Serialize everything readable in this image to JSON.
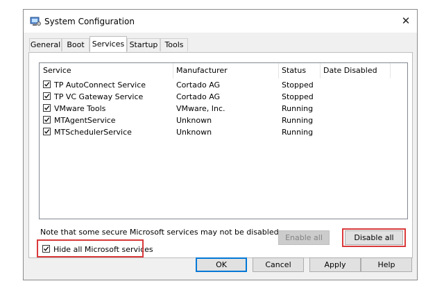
{
  "window": {
    "title": "System Configuration",
    "close_glyph": "✕"
  },
  "tabs": [
    {
      "label": "General"
    },
    {
      "label": "Boot"
    },
    {
      "label": "Services",
      "active": true
    },
    {
      "label": "Startup"
    },
    {
      "label": "Tools"
    }
  ],
  "list": {
    "columns": [
      "Service",
      "Manufacturer",
      "Status",
      "Date Disabled"
    ],
    "rows": [
      {
        "checked": true,
        "service": "TP AutoConnect Service",
        "manufacturer": "Cortado AG",
        "status": "Stopped",
        "date": ""
      },
      {
        "checked": true,
        "service": "TP VC Gateway Service",
        "manufacturer": "Cortado AG",
        "status": "Stopped",
        "date": ""
      },
      {
        "checked": true,
        "service": "VMware Tools",
        "manufacturer": "VMware, Inc.",
        "status": "Running",
        "date": ""
      },
      {
        "checked": true,
        "service": "MTAgentService",
        "manufacturer": "Unknown",
        "status": "Running",
        "date": ""
      },
      {
        "checked": true,
        "service": "MTSchedulerService",
        "manufacturer": "Unknown",
        "status": "Running",
        "date": ""
      }
    ]
  },
  "note": "Note that some secure Microsoft services may not be disabled.",
  "buttons": {
    "enable_all": "Enable all",
    "disable_all": "Disable all",
    "ok": "OK",
    "cancel": "Cancel",
    "apply": "Apply",
    "help": "Help"
  },
  "hide_microsoft": {
    "label": "Hide all Microsoft services",
    "checked": true
  },
  "colors": {
    "highlight": "#d9393a",
    "accent": "#0078d7"
  },
  "icons": {
    "app": "system-config-icon",
    "close": "close-icon",
    "check": "checkmark-icon"
  }
}
